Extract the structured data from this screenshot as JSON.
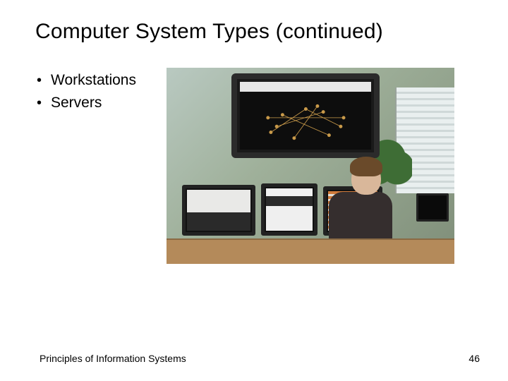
{
  "title": "Computer System Types (continued)",
  "bullets": [
    "Workstations",
    "Servers"
  ],
  "footer": {
    "source": "Principles of Information Systems",
    "page": "46"
  },
  "image_alt": "Photo of a person seated at a multi-monitor workstation with a large wall-mounted display showing a network graph"
}
